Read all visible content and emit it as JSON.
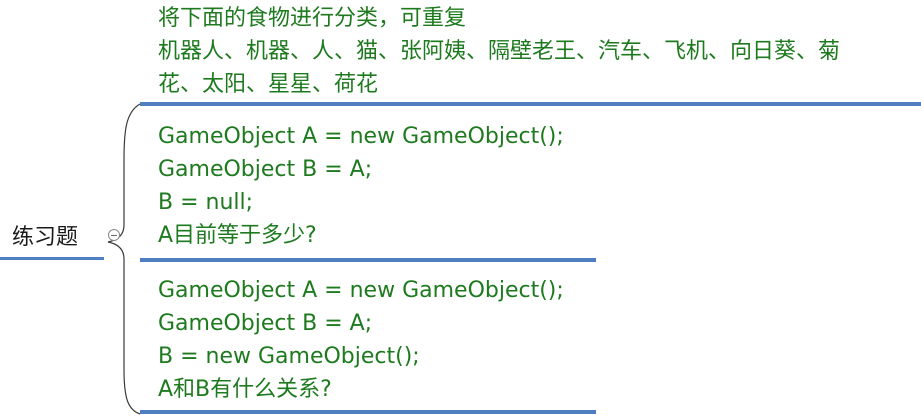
{
  "root": {
    "label": "练习题",
    "toggle_icon": "collapse-minus-icon"
  },
  "topics": [
    {
      "lines": [
        "将下面的食物进行分类，可重复",
        "机器人、机器、人、猫、张阿姨、隔壁老王、汽车、飞机、向日葵、菊",
        "花、太阳、星星、荷花"
      ]
    },
    {
      "lines": [
        "GameObject A = new GameObject();",
        "GameObject B = A;",
        "B = null;",
        "A目前等于多少?"
      ]
    },
    {
      "lines": [
        "GameObject A = new GameObject();",
        "GameObject B = A;",
        "B = new GameObject();",
        "A和B有什么关系?"
      ]
    }
  ],
  "colors": {
    "connector": "#4f7ec1",
    "topic_text": "#1e7a1e",
    "root_text": "#1a1a1a",
    "curve": "#3a3a3a"
  }
}
